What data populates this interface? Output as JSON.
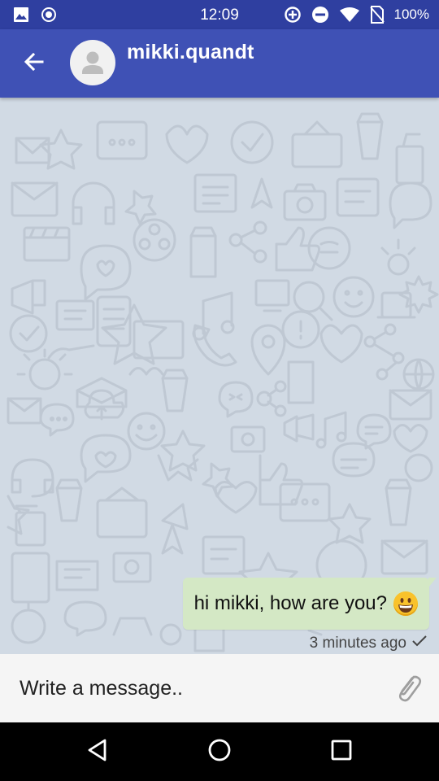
{
  "status_bar": {
    "time": "12:09",
    "battery": "100%",
    "left_icons": [
      "image-icon",
      "record-icon"
    ],
    "right_icons": [
      "data-saver-icon",
      "do-not-disturb-icon",
      "wifi-icon",
      "no-sim-icon"
    ]
  },
  "header": {
    "contact_name": "mikki.quandt",
    "back_icon": "arrow-back-icon",
    "avatar_icon": "person-icon",
    "color": "#3f51b5"
  },
  "messages": [
    {
      "text": "hi mikki, how are you?",
      "emoji": "grinning-face",
      "time": "3 minutes ago",
      "status": "sent-check-icon",
      "outgoing": true
    }
  ],
  "composer": {
    "placeholder": "Write a message..",
    "attach_icon": "paperclip-icon"
  },
  "nav_bar": {
    "buttons": [
      "back-triangle-icon",
      "home-circle-icon",
      "recents-square-icon"
    ]
  }
}
